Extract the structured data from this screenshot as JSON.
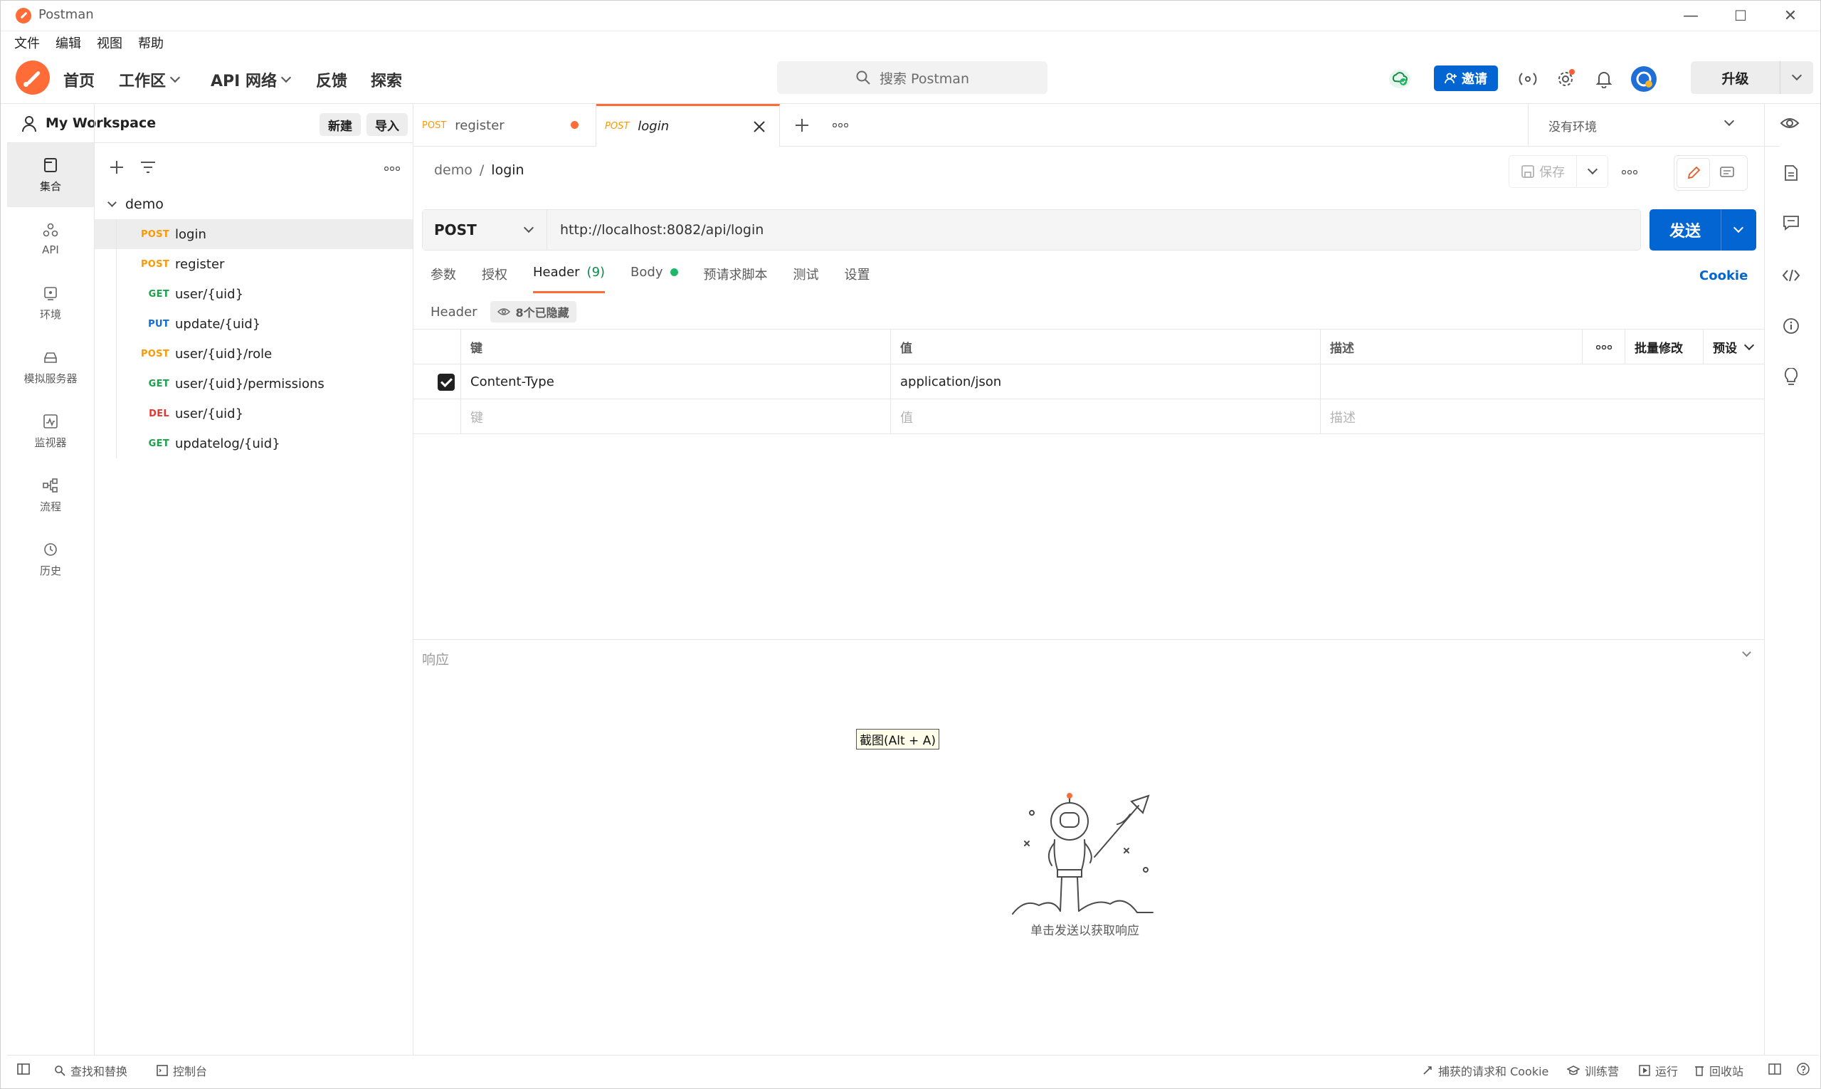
{
  "window": {
    "title": "Postman",
    "minimize": "—",
    "maximize": "☐",
    "close": "✕"
  },
  "menu": [
    "文件",
    "编辑",
    "视图",
    "帮助"
  ],
  "nav": {
    "home": "首页",
    "workspaces": "工作区",
    "api_network": "API 网络",
    "feedback": "反馈",
    "explore": "探索"
  },
  "search": {
    "placeholder": "搜索 Postman"
  },
  "topbar": {
    "invite": "邀请",
    "upgrade": "升级"
  },
  "workspace": {
    "name": "My Workspace",
    "new": "新建",
    "import": "导入"
  },
  "rail": [
    {
      "label": "集合",
      "icon": "collections-icon"
    },
    {
      "label": "API",
      "icon": "apis-icon"
    },
    {
      "label": "环境",
      "icon": "environments-icon"
    },
    {
      "label": "模拟服务器",
      "icon": "mock-servers-icon"
    },
    {
      "label": "监视器",
      "icon": "monitors-icon"
    },
    {
      "label": "流程",
      "icon": "flows-icon"
    },
    {
      "label": "历史",
      "icon": "history-icon"
    }
  ],
  "tree": {
    "folder": "demo",
    "requests": [
      {
        "method": "POST",
        "name": "login"
      },
      {
        "method": "POST",
        "name": "register"
      },
      {
        "method": "GET",
        "name": "user/{uid}"
      },
      {
        "method": "PUT",
        "name": "update/{uid}"
      },
      {
        "method": "POST",
        "name": "user/{uid}/role"
      },
      {
        "method": "GET",
        "name": "user/{uid}/permissions"
      },
      {
        "method": "DEL",
        "name": "user/{uid}"
      },
      {
        "method": "GET",
        "name": "updatelog/{uid}"
      }
    ]
  },
  "tabs": [
    {
      "method": "POST",
      "name": "register"
    },
    {
      "method": "POST",
      "name": "login"
    }
  ],
  "environment": {
    "selected": "没有环境"
  },
  "request": {
    "breadcrumb_parent": "demo",
    "breadcrumb_sep": "/",
    "breadcrumb_current": "login",
    "save": "保存",
    "method": "POST",
    "url": "http://localhost:8082/api/login",
    "send": "发送",
    "tabs": {
      "params": "参数",
      "auth": "授权",
      "headers": "Header",
      "headers_count": "(9)",
      "body": "Body",
      "prerequest": "预请求脚本",
      "tests": "测试",
      "settings": "设置"
    },
    "cookie": "Cookie",
    "headers_label": "Header",
    "hidden_headers": "8个已隐藏"
  },
  "headers_table": {
    "columns": {
      "key": "键",
      "value": "值",
      "description": "描述",
      "bulk_edit": "批量修改",
      "presets": "预设"
    },
    "rows": [
      {
        "checked": true,
        "key": "Content-Type",
        "value": "application/json",
        "description": ""
      }
    ],
    "placeholder": {
      "key": "键",
      "value": "值",
      "description": "描述"
    }
  },
  "response": {
    "label": "响应",
    "empty_text": "单击发送以获取响应",
    "screenshot_tip": "截图(Alt + A)"
  },
  "statusbar": {
    "find_replace": "查找和替换",
    "console": "控制台",
    "capture": "捕获的请求和 Cookie",
    "bootcamp": "训练营",
    "runner": "运行",
    "trash": "回收站"
  },
  "colors": {
    "brand": "#ff6c37",
    "primary": "#0265d2",
    "post": "#ff9800",
    "get": "#17a34a",
    "put": "#0d6cd6",
    "delete": "#e3382f"
  }
}
